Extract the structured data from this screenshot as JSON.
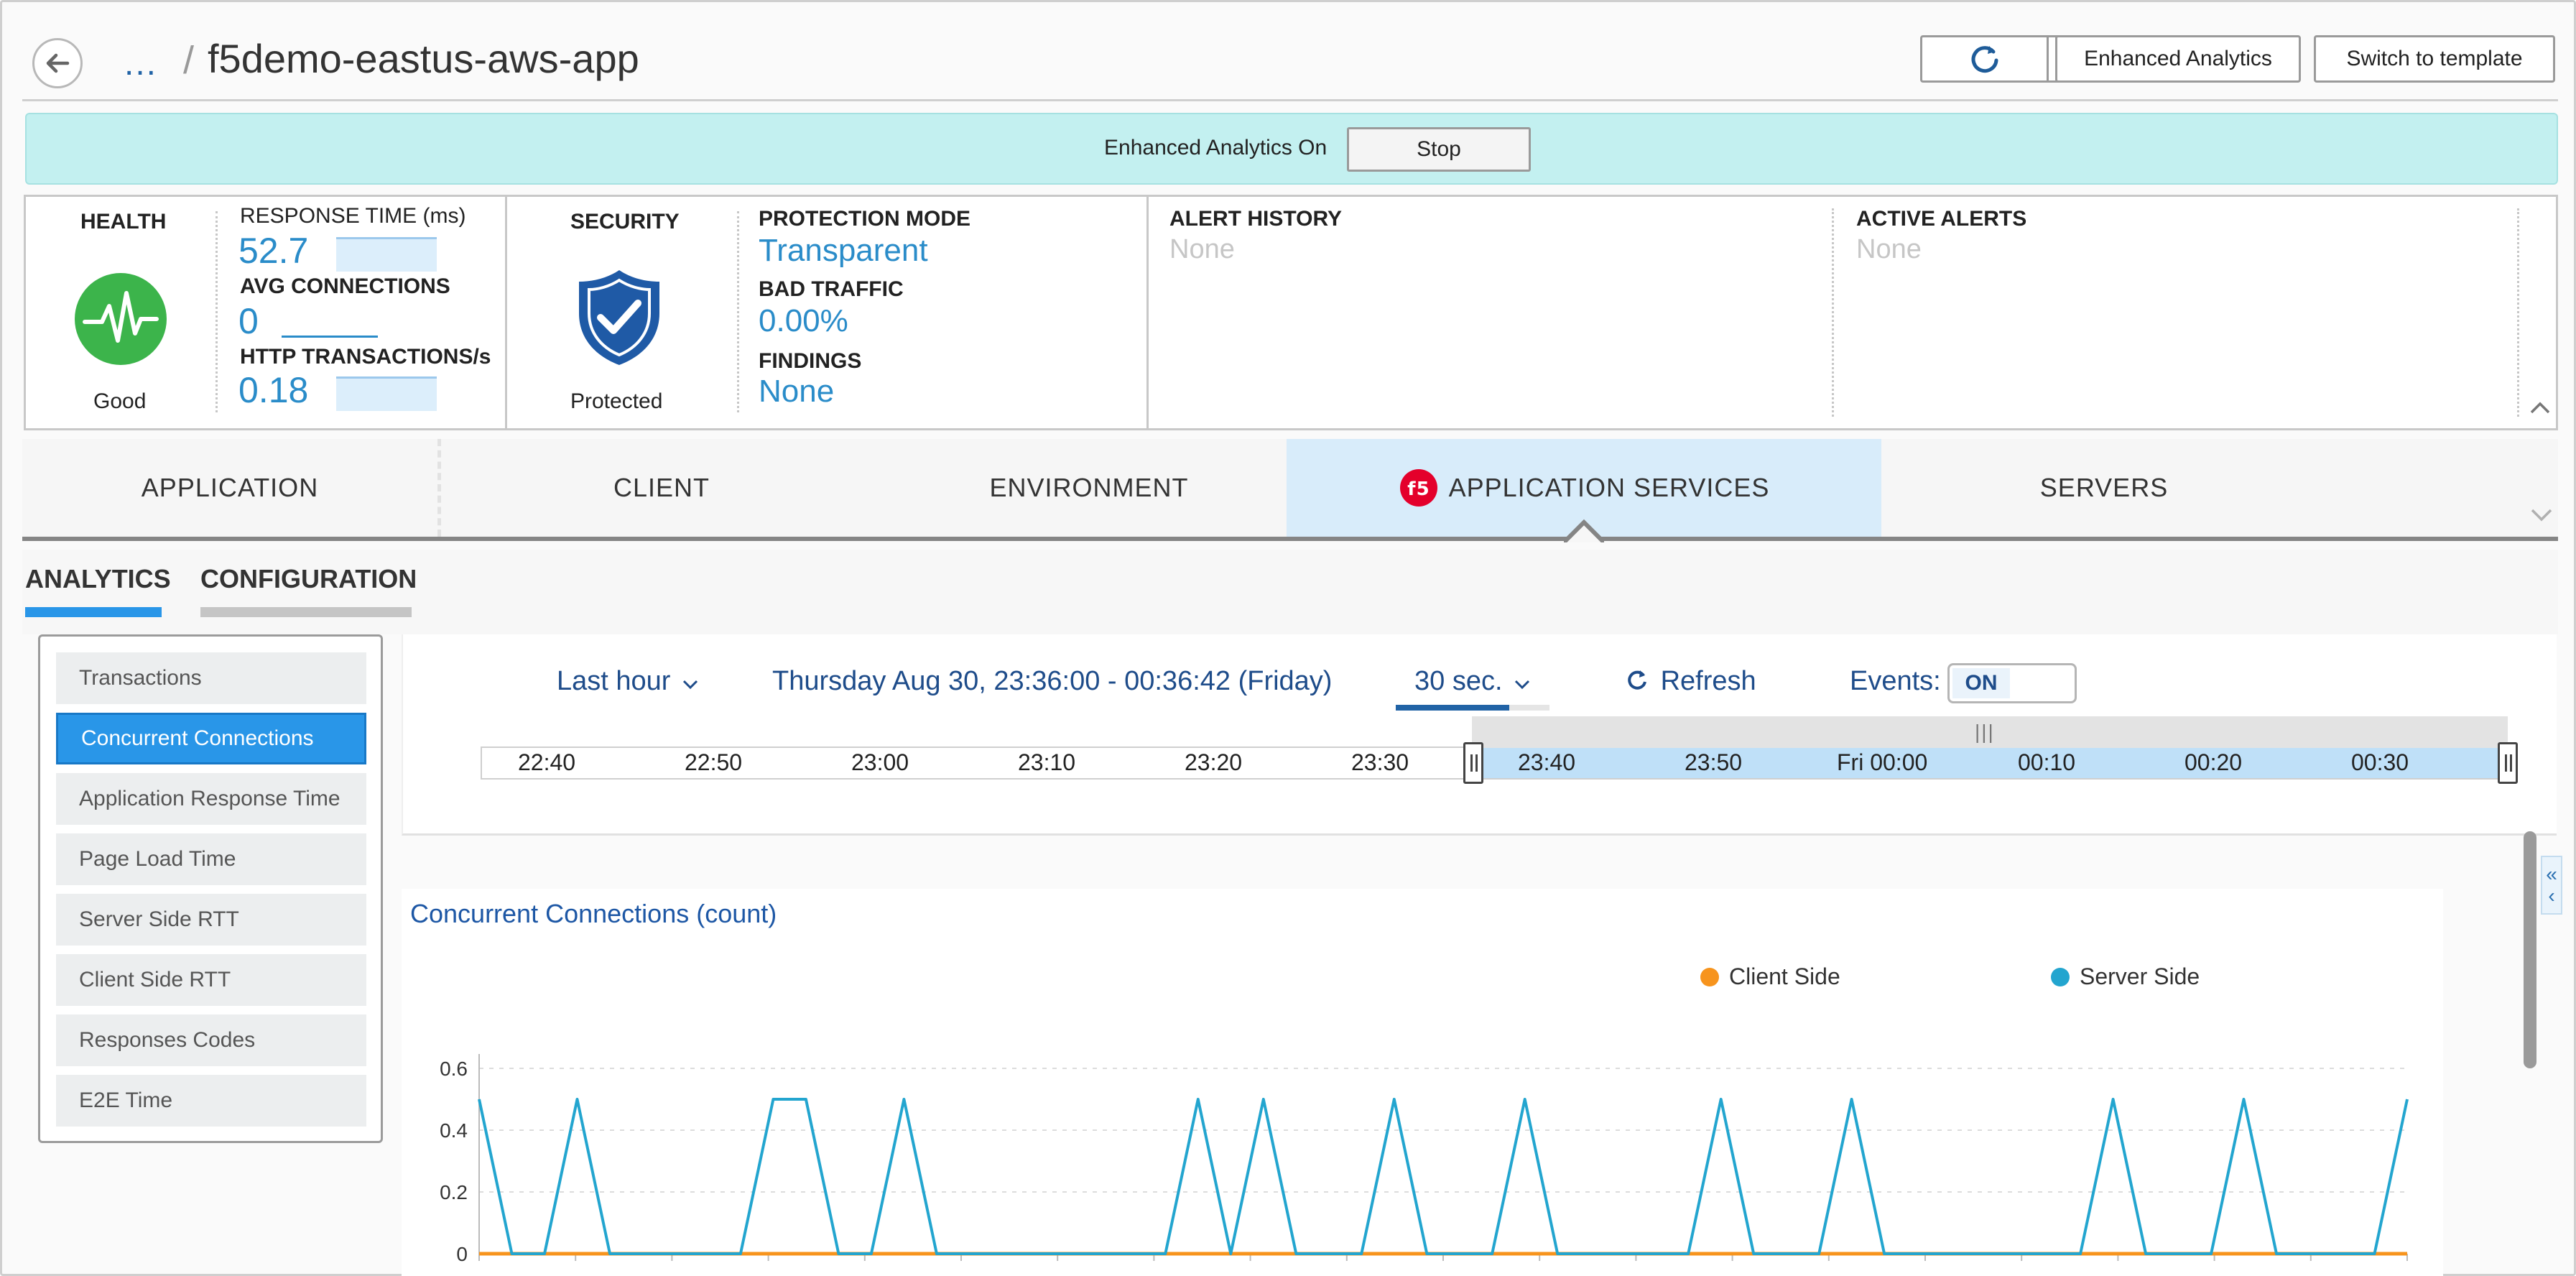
{
  "header": {
    "breadcrumb_ellipsis": "...",
    "separator": "/",
    "title": "f5demo-eastus-aws-app",
    "buttons": {
      "enhanced_analytics": "Enhanced Analytics",
      "switch_template": "Switch to template"
    }
  },
  "banner": {
    "text": "Enhanced Analytics On",
    "stop_label": "Stop"
  },
  "summary": {
    "health": {
      "label": "HEALTH",
      "status": "Good",
      "color": "#3cb44b"
    },
    "response_time": {
      "label": "RESPONSE TIME (ms)",
      "value": "52.7"
    },
    "avg_connections": {
      "label": "AVG CONNECTIONS",
      "value": "0"
    },
    "http_transactions": {
      "label": "HTTP TRANSACTIONS/s",
      "value": "0.18"
    },
    "security": {
      "label": "SECURITY",
      "status": "Protected"
    },
    "protection_mode": {
      "label": "PROTECTION MODE",
      "value": "Transparent"
    },
    "bad_traffic": {
      "label": "BAD TRAFFIC",
      "value": "0.00%"
    },
    "findings": {
      "label": "FINDINGS",
      "value": "None"
    },
    "alert_history": {
      "label": "ALERT HISTORY",
      "value": "None"
    },
    "active_alerts": {
      "label": "ACTIVE ALERTS",
      "value": "None"
    }
  },
  "tabs": [
    {
      "label": "APPLICATION"
    },
    {
      "label": "CLIENT"
    },
    {
      "label": "ENVIRONMENT"
    },
    {
      "label": "APPLICATION SERVICES",
      "icon": "f5",
      "active": true
    },
    {
      "label": "SERVERS"
    }
  ],
  "subtabs": {
    "analytics": "ANALYTICS",
    "configuration": "CONFIGURATION"
  },
  "metrics": [
    "Transactions",
    "Concurrent Connections",
    "Application Response Time",
    "Page Load Time",
    "Server Side RTT",
    "Client Side RTT",
    "Responses Codes",
    "E2E Time"
  ],
  "selected_metric": "Concurrent Connections",
  "time_controls": {
    "range": "Last hour",
    "date_range": "Thursday Aug 30, 23:36:00 - 00:36:42 (Friday)",
    "interval": "30 sec.",
    "refresh": "Refresh",
    "events_label": "Events:",
    "events_state": "ON",
    "grab_mark": "|||",
    "timeline_ticks": [
      "22:40",
      "22:50",
      "23:00",
      "23:10",
      "23:20",
      "23:30",
      "23:40",
      "23:50",
      "Fri 00:00",
      "00:10",
      "00:20",
      "00:30"
    ]
  },
  "chart_data": {
    "type": "line",
    "title": "Concurrent Connections (count)",
    "legend_position": "top",
    "ylim": [
      0,
      0.6
    ],
    "yticks": [
      "0.6",
      "0.4",
      "0.2",
      "0"
    ],
    "grid": true,
    "series": [
      {
        "name": "Client Side",
        "color": "#f7941d",
        "values": [
          0,
          0,
          0,
          0,
          0,
          0,
          0,
          0,
          0,
          0,
          0,
          0,
          0,
          0,
          0,
          0,
          0,
          0,
          0,
          0,
          0,
          0,
          0,
          0,
          0,
          0,
          0,
          0,
          0,
          0,
          0,
          0,
          0,
          0,
          0,
          0,
          0,
          0,
          0,
          0,
          0,
          0,
          0,
          0,
          0,
          0,
          0,
          0,
          0,
          0,
          0,
          0,
          0,
          0,
          0,
          0,
          0,
          0,
          0,
          0
        ]
      },
      {
        "name": "Server Side",
        "color": "#23a5cf",
        "values": [
          0.5,
          0,
          0,
          0.5,
          0,
          0,
          0,
          0,
          0,
          0.5,
          0.5,
          0,
          0,
          0.5,
          0,
          0,
          0,
          0,
          0,
          0,
          0,
          0,
          0.5,
          0,
          0.5,
          0,
          0,
          0,
          0.5,
          0,
          0,
          0,
          0.5,
          0,
          0,
          0,
          0,
          0,
          0.5,
          0,
          0,
          0,
          0.5,
          0,
          0,
          0,
          0,
          0,
          0,
          0,
          0.5,
          0,
          0,
          0,
          0.5,
          0,
          0,
          0,
          0,
          0.5
        ]
      }
    ]
  }
}
